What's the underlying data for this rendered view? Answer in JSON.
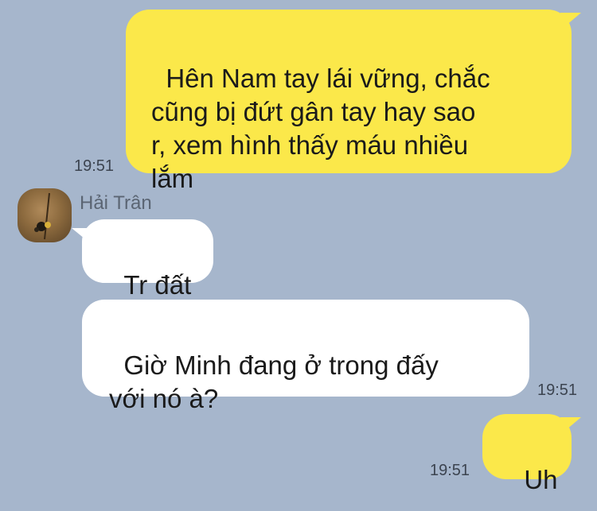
{
  "messages": [
    {
      "direction": "out",
      "text": "Hên Nam tay lái vững, chắc\ncũng bị đứt gân tay hay sao\nr, xem hình thấy máu nhiều\nlắm",
      "time": "19:51"
    },
    {
      "direction": "in",
      "sender": "Hải Trân",
      "text": "Tr đất"
    },
    {
      "direction": "in",
      "text": "Giờ Minh đang ở trong đấy\nvới nó à?",
      "time": "19:51"
    },
    {
      "direction": "out",
      "text": "Uh",
      "time": "19:51"
    }
  ],
  "colors": {
    "background": "#a6b6cc",
    "outgoing_bubble": "#fbe84a",
    "incoming_bubble": "#ffffff"
  }
}
